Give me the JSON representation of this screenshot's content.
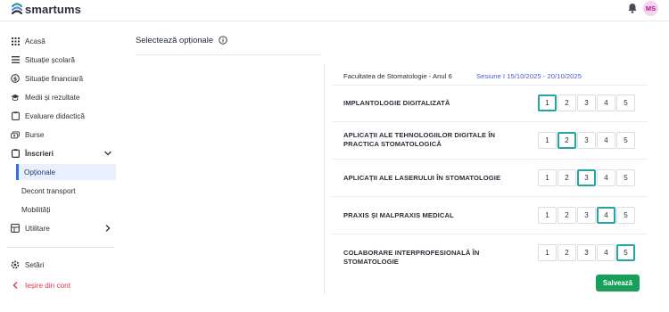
{
  "app": {
    "logo_text": "smartums",
    "avatar_initials": "MS"
  },
  "sidebar": {
    "items": [
      {
        "label": "Acasă",
        "icon": "grid-icon"
      },
      {
        "label": "Situație școlară",
        "icon": "list-icon"
      },
      {
        "label": "Situație financiară",
        "icon": "dollar-icon"
      },
      {
        "label": "Medii și rezultate",
        "icon": "graduation-cap-icon"
      },
      {
        "label": "Evaluare didactică",
        "icon": "clipboard-icon"
      },
      {
        "label": "Burse",
        "icon": "money-icon"
      },
      {
        "label": "Înscrieri",
        "icon": "clipboard-check-icon",
        "expanded": true
      },
      {
        "label": "Utilitare",
        "icon": "layout-icon"
      }
    ],
    "sub_items": [
      {
        "label": "Opționale",
        "active": true
      },
      {
        "label": "Decont transport"
      },
      {
        "label": "Mobilități"
      }
    ],
    "settings": "Setări",
    "logout": "Ieșire din cont"
  },
  "main": {
    "title": "Selectează opționale",
    "faculty": "Facultatea de Stomatologie - Anul 6",
    "session": "Sesiune I 15/10/2025 - 20/10/2025",
    "grade_options": [
      "1",
      "2",
      "3",
      "4",
      "5"
    ],
    "courses": [
      {
        "name": "IMPLANTOLOGIE DIGITALIZATĂ",
        "selected": 1
      },
      {
        "name": "APLICAȚII ALE TEHNOLOGIILOR DIGITALE ÎN PRACTICA STOMATOLOGICĂ",
        "selected": 2
      },
      {
        "name": "APLICAȚII ALE LASERULUI ÎN STOMATOLOGIE",
        "selected": 3
      },
      {
        "name": "PRAXIS ȘI MALPRAXIS MEDICAL",
        "selected": 4
      },
      {
        "name": "COLABORARE INTERPROFESIONALĂ ÎN STOMATOLOGIE",
        "selected": 5
      }
    ],
    "save_label": "Salvează"
  },
  "colors": {
    "accent_teal": "#1fa7a0",
    "save_green": "#18a05b",
    "active_blue": "#2b74e0",
    "session_blue": "#4b5bd6",
    "logout_red": "#e0354b"
  }
}
